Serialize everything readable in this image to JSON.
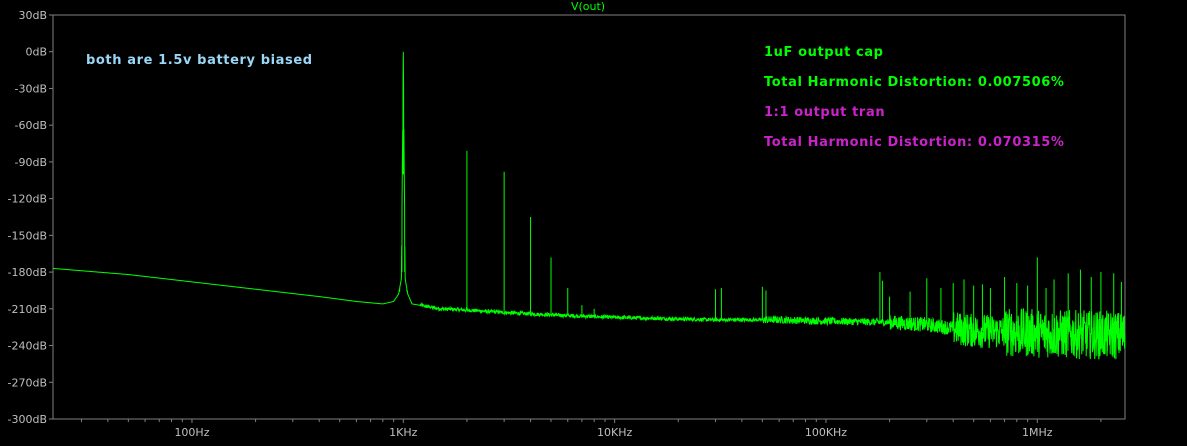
{
  "chart_data": {
    "type": "line",
    "title": "V(out)",
    "xlabel": "",
    "ylabel": "",
    "x_scale": "log",
    "xlim": [
      22,
      2600000
    ],
    "ylim": [
      -300,
      30
    ],
    "y_ticks": [
      "30dB",
      "0dB",
      "-30dB",
      "-60dB",
      "-90dB",
      "-120dB",
      "-150dB",
      "-180dB",
      "-210dB",
      "-240dB",
      "-270dB",
      "-300dB"
    ],
    "y_tick_values": [
      30,
      0,
      -30,
      -60,
      -90,
      -120,
      -150,
      -180,
      -210,
      -240,
      -270,
      -300
    ],
    "x_ticks": [
      "100Hz",
      "1KHz",
      "10KHz",
      "100KHz",
      "1MHz"
    ],
    "x_tick_values": [
      100,
      1000,
      10000,
      100000,
      1000000
    ],
    "grid": false,
    "colors": {
      "background": "#000000",
      "axes": "#808080",
      "series_cap": "#00ff00",
      "ann_note": "#9ad6f5",
      "ann_cap": "#00ff00",
      "ann_tran": "#cc22cc"
    },
    "series": [
      {
        "baseline": [
          [
            22,
            -177
          ],
          [
            50,
            -182
          ],
          [
            100,
            -188
          ],
          [
            200,
            -194
          ],
          [
            400,
            -200
          ],
          [
            600,
            -204
          ],
          [
            800,
            -206
          ],
          [
            900,
            -204
          ],
          [
            950,
            -198
          ],
          [
            980,
            -185
          ],
          [
            1000,
            0
          ],
          [
            1020,
            -185
          ],
          [
            1050,
            -198
          ],
          [
            1100,
            -206
          ],
          [
            1500,
            -210
          ],
          [
            2000,
            -211
          ],
          [
            3000,
            -213
          ],
          [
            5000,
            -215
          ],
          [
            10000,
            -217
          ],
          [
            30000,
            -219
          ],
          [
            60000,
            -219
          ],
          [
            100000,
            -220
          ],
          [
            200000,
            -221
          ],
          [
            300000,
            -223
          ],
          [
            500000,
            -228
          ],
          [
            1000000,
            -230
          ],
          [
            2600000,
            -232
          ]
        ],
        "spikes": [
          [
            2000,
            -81
          ],
          [
            3000,
            -98
          ],
          [
            4000,
            -135
          ],
          [
            5000,
            -168
          ],
          [
            6000,
            -193
          ],
          [
            7000,
            -207
          ],
          [
            8000,
            -210
          ],
          [
            30000,
            -194
          ],
          [
            32000,
            -193
          ],
          [
            50000,
            -192
          ],
          [
            52000,
            -195
          ],
          [
            180000,
            -180
          ],
          [
            185000,
            -187
          ],
          [
            200000,
            -200
          ],
          [
            250000,
            -196
          ],
          [
            300000,
            -185
          ],
          [
            350000,
            -193
          ],
          [
            400000,
            -189
          ],
          [
            450000,
            -186
          ],
          [
            500000,
            -191
          ],
          [
            550000,
            -190
          ],
          [
            600000,
            -193
          ],
          [
            700000,
            -184
          ],
          [
            800000,
            -189
          ],
          [
            900000,
            -191
          ],
          [
            1000000,
            -168
          ],
          [
            1100000,
            -193
          ],
          [
            1200000,
            -186
          ],
          [
            1400000,
            -181
          ],
          [
            1600000,
            -178
          ],
          [
            1800000,
            -184
          ],
          [
            2000000,
            -180
          ],
          [
            2300000,
            -181
          ],
          [
            2500000,
            -188
          ]
        ]
      }
    ],
    "annotations": {
      "note": "both are 1.5v battery biased",
      "cap_label": "1uF output cap",
      "cap_thd": "Total Harmonic Distortion: 0.007506%",
      "tran_label": "1:1 output tran",
      "tran_thd": "Total Harmonic Distortion: 0.070315%"
    }
  }
}
